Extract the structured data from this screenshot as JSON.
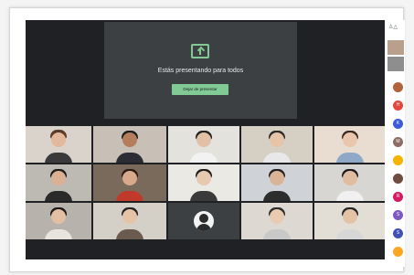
{
  "presentation": {
    "message": "Estás presentando para todos",
    "stop_label": "Dejar de presentar"
  },
  "sidebar": {
    "people_icon": "people-icon",
    "avatars": [
      {
        "letter": "",
        "color": "#b0643c"
      },
      {
        "letter": "H",
        "color": "#e8453c"
      },
      {
        "letter": "K",
        "color": "#3b5bdb"
      },
      {
        "letter": "M",
        "color": "#8d6e63"
      },
      {
        "letter": "",
        "color": "#f4b400"
      },
      {
        "letter": "",
        "color": "#6d4c41"
      },
      {
        "letter": "R",
        "color": "#d81b60"
      },
      {
        "letter": "S",
        "color": "#7e57c2"
      },
      {
        "letter": "S",
        "color": "#3f51b5"
      },
      {
        "letter": "",
        "color": "#f9a825"
      }
    ]
  },
  "colors": {
    "accent": "#81c995",
    "background": "#202124",
    "panel": "#3c4043"
  }
}
